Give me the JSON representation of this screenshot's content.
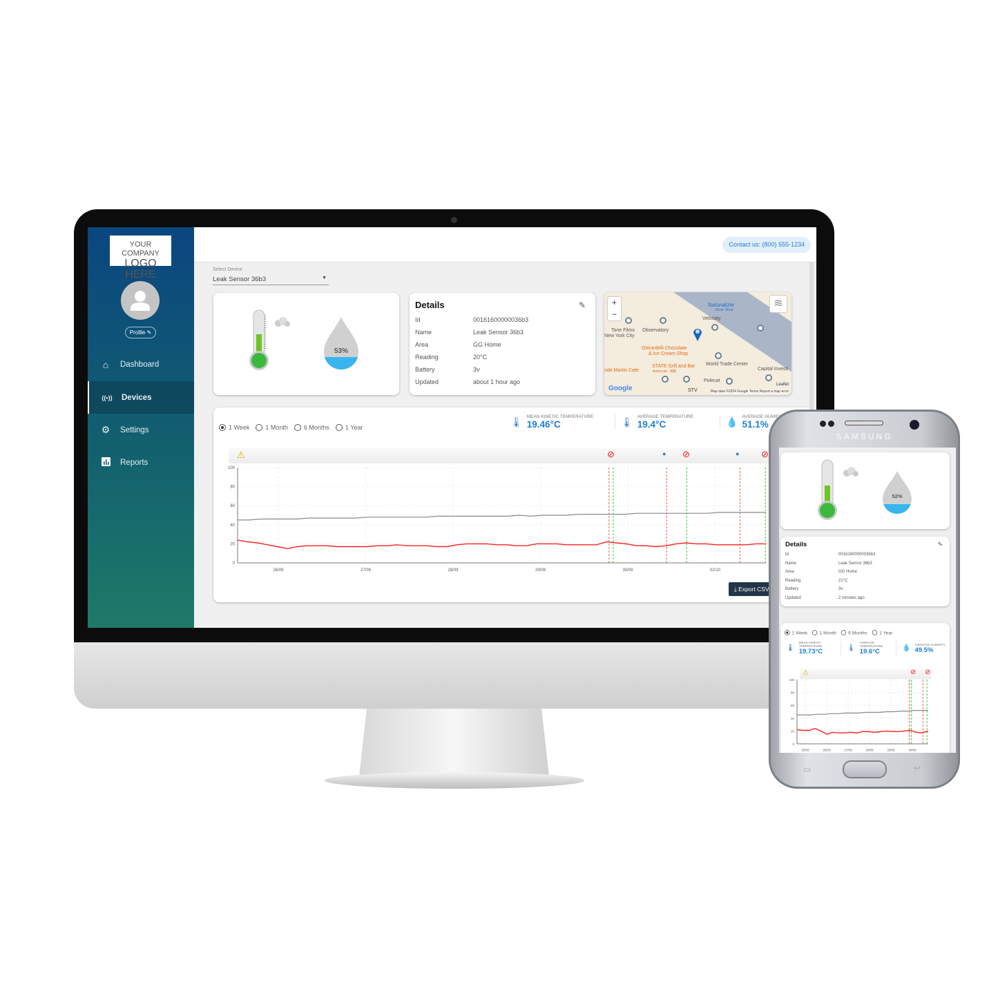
{
  "sidebar": {
    "logo_line1": "YOUR COMPANY",
    "logo_line2": "LOGO HERE",
    "profile_label": "Profile",
    "items": [
      {
        "label": "Dashboard",
        "icon": "home-icon",
        "active": false
      },
      {
        "label": "Devices",
        "icon": "broadcast-icon",
        "active": true
      },
      {
        "label": "Settings",
        "icon": "gear-icon",
        "active": false
      },
      {
        "label": "Reports",
        "icon": "bar-chart-icon",
        "active": false
      }
    ]
  },
  "header": {
    "contact": "Contact us: (800) 555-1234"
  },
  "device_select": {
    "label": "Select Device",
    "value": "Leak Sensor 36b3"
  },
  "gauges": {
    "humidity": "53%",
    "temperature_fill_percent": 45
  },
  "details": {
    "title": "Details",
    "rows": [
      {
        "k": "Id",
        "v": "00161600000036b3"
      },
      {
        "k": "Name",
        "v": "Leak Sensor 36b3"
      },
      {
        "k": "Area",
        "v": "GG Home"
      },
      {
        "k": "Reading",
        "v": "20°C"
      },
      {
        "k": "Battery",
        "v": "3v"
      },
      {
        "k": "Updated",
        "v": "about 1 hour ago"
      }
    ]
  },
  "map": {
    "labels": [
      "Naturalizer",
      "Shoe Shop",
      "Velosaty",
      "Tone Films",
      "New York City",
      "Observatory",
      "Ghirardelli Chocolate",
      "& Ice Cream Shop",
      "STATE Grill and Bar",
      "American · $$$",
      "World Trade Center",
      "Capital Investi",
      "nde Martin Cafe",
      "Polecat",
      "STV"
    ],
    "attribution": "Map data ©2024 Google  Terms  Report a map error",
    "leaflet": "Leaflet",
    "google": "Google"
  },
  "ranges": [
    "1 Week",
    "1 Month",
    "6 Months",
    "1 Year"
  ],
  "selected_range": "1 Week",
  "stats": [
    {
      "label": "MEAN KINETIC TEMPERATURE",
      "value": "19.46°C"
    },
    {
      "label": "AVERAGE TEMPERATURE",
      "value": "19.4°C"
    },
    {
      "label": "AVERAGE HUMIDITY",
      "value": "51.1%"
    }
  ],
  "export_label": "Export CSV",
  "colors": {
    "accent": "#1a7ed6",
    "temperature": "#ff2020",
    "humidity": "#888888",
    "sidebar_top": "#0b4680",
    "sidebar_bottom": "#1e7a68"
  },
  "chart_data": [
    {
      "type": "line",
      "ylim": [
        0,
        100
      ],
      "yticks": [
        0,
        20,
        40,
        60,
        80,
        100
      ],
      "xticks": [
        "26/09",
        "27/09",
        "28/09",
        "29/09",
        "30/09",
        "02/10"
      ],
      "grid": true,
      "series": [
        {
          "color": "#888888",
          "values": [
            45,
            45,
            46,
            46,
            46,
            46,
            47,
            47,
            47,
            47,
            47,
            48,
            48,
            48,
            48,
            48,
            48,
            49,
            49,
            49,
            49,
            49,
            49,
            49,
            50,
            49,
            50,
            50,
            50,
            51,
            51,
            51,
            51,
            51,
            52,
            52,
            52,
            52,
            52,
            52,
            52,
            53,
            53,
            53,
            53,
            53
          ]
        },
        {
          "color": "#ff2020",
          "values": [
            24,
            22,
            21,
            19,
            17,
            15,
            17,
            18,
            18,
            18,
            17,
            17,
            17,
            17,
            18,
            18,
            19,
            18,
            18,
            18,
            17,
            17,
            19,
            20,
            20,
            20,
            19,
            19,
            18,
            18,
            20,
            20,
            20,
            19,
            19,
            19,
            19,
            22,
            21,
            20,
            18,
            18,
            17,
            18,
            20,
            21,
            20,
            20,
            19,
            19,
            19,
            19,
            20,
            20
          ]
        }
      ]
    },
    {
      "type": "line",
      "ylim": [
        0,
        100
      ],
      "yticks": [
        0,
        20,
        40,
        60,
        80,
        100
      ],
      "xticks": [
        "25/09",
        "26/09",
        "27/09",
        "28/09",
        "29/09",
        "30/09"
      ],
      "grid": true,
      "series": [
        {
          "color": "#888888",
          "values": [
            45,
            45,
            45,
            46,
            46,
            47,
            47,
            48,
            48,
            48,
            49,
            49,
            49,
            50,
            50,
            51,
            51,
            52,
            52,
            52
          ]
        },
        {
          "color": "#ff2020",
          "values": [
            22,
            21,
            21,
            24,
            20,
            15,
            18,
            17,
            17,
            18,
            17,
            19,
            19,
            18,
            19,
            20,
            19,
            19,
            20,
            21,
            18,
            17,
            20
          ]
        }
      ]
    }
  ],
  "phone": {
    "brand": "SAMSUNG",
    "humidity": "52%",
    "details_title": "Details",
    "rows": [
      {
        "k": "Id",
        "v": "00161600000036b3"
      },
      {
        "k": "Name",
        "v": "Leak Sensor 36b3"
      },
      {
        "k": "Area",
        "v": "GG Home"
      },
      {
        "k": "Reading",
        "v": "21°C"
      },
      {
        "k": "Battery",
        "v": "3v"
      },
      {
        "k": "Updated",
        "v": "2 minutes ago"
      }
    ],
    "stats": [
      {
        "label": "MEAN KINETIC TEMPERATURE",
        "value": "19.73°C"
      },
      {
        "label": "AVERAGE TEMPERATURE",
        "value": "19.6°C"
      },
      {
        "label": "AVERAGE HUMIDITY",
        "value": "49.5%"
      }
    ]
  }
}
